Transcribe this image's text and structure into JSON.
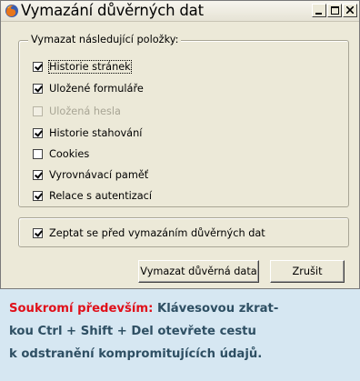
{
  "window": {
    "title": "Vymazání důvěrných dat",
    "app_icon": "firefox-icon",
    "controls": [
      "minimize-icon",
      "maximize-icon",
      "close-icon"
    ]
  },
  "group": {
    "legend": "Vymazat následující položky:"
  },
  "items": [
    {
      "label": "Historie stránek",
      "checked": true,
      "enabled": true,
      "focused": true
    },
    {
      "label": "Uložené formuláře",
      "checked": true,
      "enabled": true
    },
    {
      "label": "Uložená hesla",
      "checked": false,
      "enabled": false
    },
    {
      "label": "Historie stahování",
      "checked": true,
      "enabled": true
    },
    {
      "label": "Cookies",
      "checked": false,
      "enabled": true
    },
    {
      "label": "Vyrovnávací paměť",
      "checked": true,
      "enabled": true
    },
    {
      "label": "Relace s autentizací",
      "checked": true,
      "enabled": true
    }
  ],
  "ask": {
    "label": "Zeptat se před vymazáním důvěrných dat",
    "checked": true
  },
  "buttons": {
    "clear": "Vymazat důvěrná data",
    "cancel": "Zrušit"
  },
  "caption": {
    "highlight": "Soukromí především:",
    "line1_rest": " Klávesovou zkrat-",
    "line2": "kou Ctrl + Shift + Del otevřete cestu",
    "line3": "k odstranění kompromitujících údajů."
  },
  "colors": {
    "caption_bg": "#d6e7f2",
    "caption_text": "#2e4f63",
    "highlight": "#e0101a",
    "dialog_bg": "#ece9d8"
  }
}
